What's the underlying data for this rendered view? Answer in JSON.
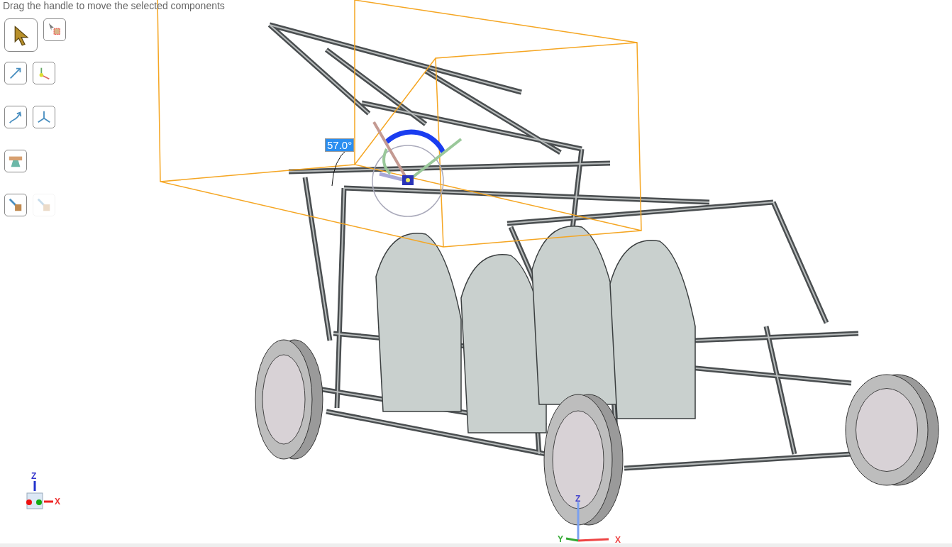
{
  "hint": "Drag the handle to move the selected components",
  "toolbar": [
    [
      {
        "kind": "select",
        "selected": true,
        "disabled": false
      },
      {
        "kind": "select-box",
        "selected": false,
        "disabled": false
      }
    ],
    [
      {
        "kind": "move-arrow",
        "selected": false,
        "disabled": false
      },
      {
        "kind": "triad-move",
        "selected": false,
        "disabled": false
      }
    ],
    [
      {
        "kind": "curve-arrow",
        "selected": false,
        "disabled": false
      },
      {
        "kind": "axes",
        "selected": false,
        "disabled": false
      }
    ],
    [
      {
        "kind": "beam",
        "selected": false,
        "disabled": false
      }
    ],
    [
      {
        "kind": "arrow-box",
        "selected": false,
        "disabled": false
      },
      {
        "kind": "arrow-box",
        "selected": false,
        "disabled": true
      }
    ]
  ],
  "angle_label": "57.0°",
  "view_triad": {
    "z": "Z",
    "x": "X"
  },
  "origin_triad": {
    "z": "Z",
    "y": "Y",
    "x": "X"
  }
}
